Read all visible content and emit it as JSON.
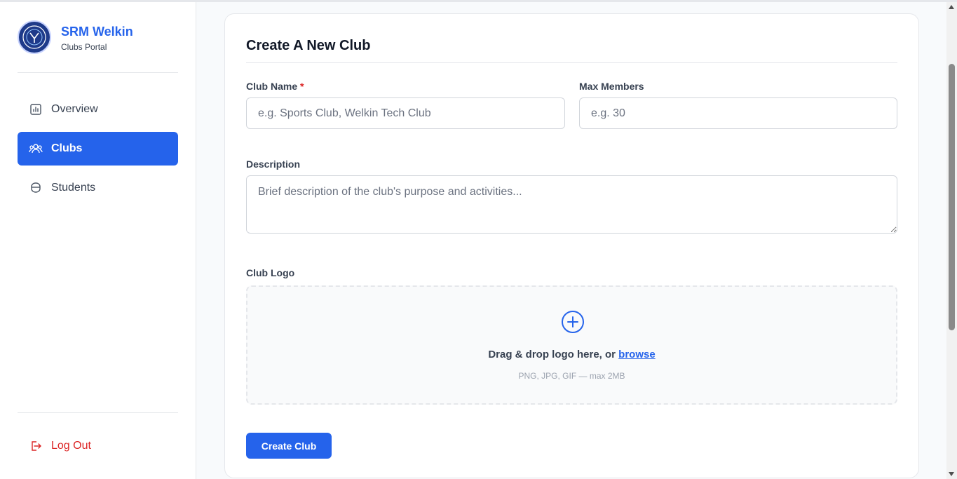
{
  "brand": {
    "name": "SRM Welkin",
    "subtitle": "Clubs Portal"
  },
  "sidebar": {
    "items": [
      {
        "label": "Overview",
        "icon": "chart-icon",
        "active": false
      },
      {
        "label": "Clubs",
        "icon": "users-icon",
        "active": true
      },
      {
        "label": "Students",
        "icon": "graduation-cap-icon",
        "active": false
      }
    ],
    "logout_label": "Log Out"
  },
  "form": {
    "title": "Create A New Club",
    "club_name": {
      "label": "Club Name",
      "required_mark": "*",
      "placeholder": "e.g. Sports Club, Welkin Tech Club",
      "value": ""
    },
    "max_members": {
      "label": "Max Members",
      "placeholder": "e.g. 30",
      "value": ""
    },
    "description": {
      "label": "Description",
      "placeholder": "Brief description of the club's purpose and activities...",
      "value": ""
    },
    "logo": {
      "label": "Club Logo",
      "drop_text": "Drag & drop logo here, or",
      "browse_text": "browse",
      "hint": "PNG, JPG, GIF — max 2MB"
    },
    "submit_label": "Create Club"
  },
  "colors": {
    "accent": "#2563eb",
    "danger": "#dc2626",
    "border": "#e5e7eb",
    "text": "#374151"
  }
}
